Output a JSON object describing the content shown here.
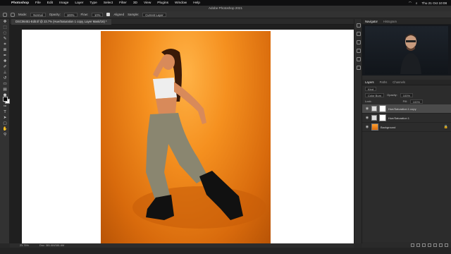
{
  "menubar": {
    "items": [
      "Photoshop",
      "File",
      "Edit",
      "Image",
      "Layer",
      "Type",
      "Select",
      "Filter",
      "3D",
      "View",
      "Plugins",
      "Window",
      "Help"
    ],
    "clock": "Thu 21 Oct 10:08"
  },
  "titlebar": {
    "title": "Adobe Photoshop 2021"
  },
  "options": {
    "mode_label": "Mode:",
    "mode_value": "Normal",
    "opacity_label": "Opacity:",
    "opacity_value": "100%",
    "flow_label": "Flow:",
    "flow_value": "10%",
    "aligned_label": "Aligned",
    "sample_label": "Sample:",
    "sample_value": "Current Layer"
  },
  "document": {
    "tab_title": "DSC06451-Edit.tif @ 23.7% (Hue/Saturation 1 copy, Layer Mask/16) *"
  },
  "statusbar": {
    "zoom": "23.75%",
    "doc_size": "Doc: 381.6M/381.6M"
  },
  "panels": {
    "top_tabs": [
      "Navigator",
      "Histogram"
    ],
    "layer_tabs": [
      "Layers",
      "Paths",
      "Channels"
    ],
    "kind_label": "Kind",
    "blend_mode": "Color Burn",
    "opacity_label": "Opacity:",
    "opacity_value": "100%",
    "lock_label": "Lock:",
    "fill_label": "Fill:",
    "fill_value": "100%",
    "layers": [
      {
        "name": "Hue/Saturation 1 copy",
        "selected": true
      },
      {
        "name": "Hue/Saturation 1",
        "selected": false
      },
      {
        "name": "Background",
        "selected": false
      }
    ]
  }
}
